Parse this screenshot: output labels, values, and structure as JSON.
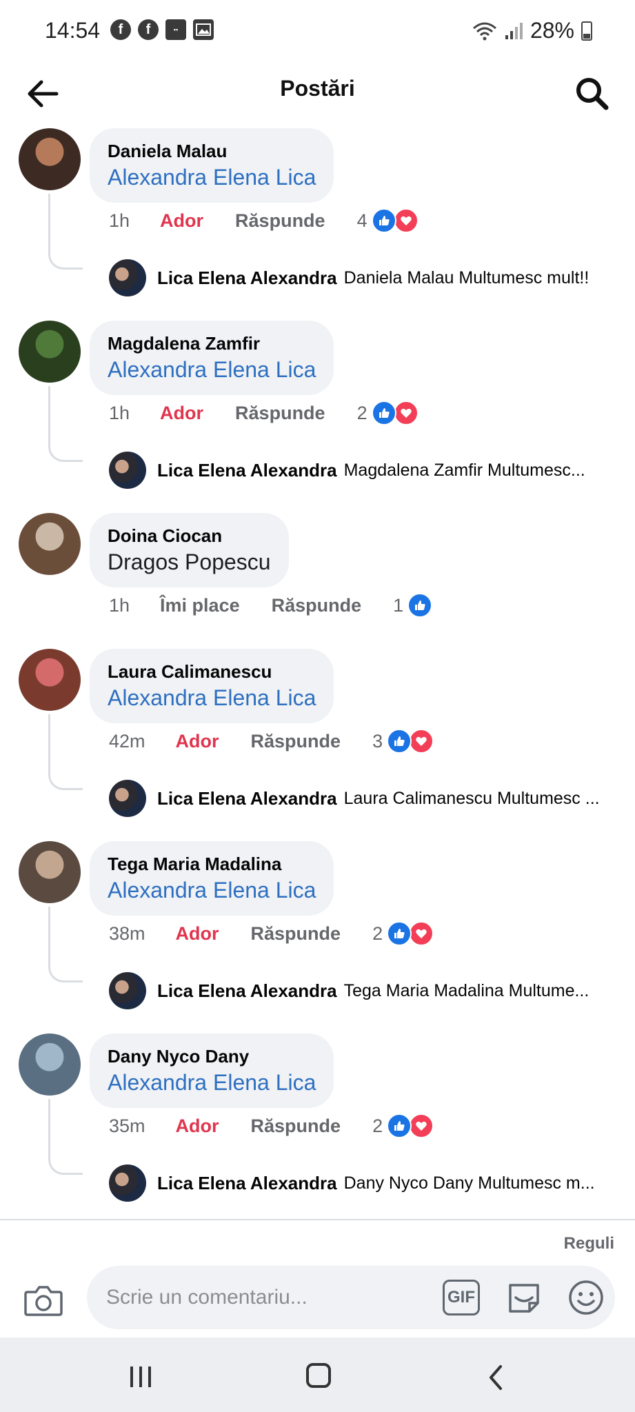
{
  "status_bar": {
    "time": "14:54",
    "battery": "28%",
    "left_icons": [
      "facebook-icon",
      "facebook-icon",
      "app-badge-icon",
      "gallery-icon"
    ]
  },
  "header": {
    "title": "Postări"
  },
  "colors": {
    "mention": "#2d6fc0",
    "love_reaction": "#e0354e",
    "like_blue": "#1b74e4",
    "bubble_bg": "#f0f2f5"
  },
  "comments": [
    {
      "author": "Daniela Malau",
      "text": "Alexandra Elena Lica",
      "is_mention": true,
      "time": "1h",
      "reaction_label": "Ador",
      "reply_label": "Răspunde",
      "reaction_count": "4",
      "reactions": [
        "like",
        "love"
      ],
      "reply": {
        "author": "Lica Elena Alexandra",
        "text": "Daniela Malau Multumesc mult!!"
      }
    },
    {
      "author": "Magdalena Zamfir",
      "text": "Alexandra Elena Lica",
      "is_mention": true,
      "time": "1h",
      "reaction_label": "Ador",
      "reply_label": "Răspunde",
      "reaction_count": "2",
      "reactions": [
        "like",
        "love"
      ],
      "reply": {
        "author": "Lica Elena Alexandra",
        "text": "Magdalena Zamfir Multumesc..."
      }
    },
    {
      "author": "Doina Ciocan",
      "text": "Dragos Popescu",
      "is_mention": false,
      "time": "1h",
      "reaction_label": "Îmi place",
      "reply_label": "Răspunde",
      "reaction_count": "1",
      "reactions": [
        "like"
      ]
    },
    {
      "author": "Laura Calimanescu",
      "text": "Alexandra Elena Lica",
      "is_mention": true,
      "time": "42m",
      "reaction_label": "Ador",
      "reply_label": "Răspunde",
      "reaction_count": "3",
      "reactions": [
        "like",
        "love"
      ],
      "reply": {
        "author": "Lica Elena Alexandra",
        "text": "Laura Calimanescu Multumesc ..."
      }
    },
    {
      "author": "Tega Maria Madalina",
      "text": "Alexandra Elena Lica",
      "is_mention": true,
      "time": "38m",
      "reaction_label": "Ador",
      "reply_label": "Răspunde",
      "reaction_count": "2",
      "reactions": [
        "like",
        "love"
      ],
      "reply": {
        "author": "Lica Elena Alexandra",
        "text": "Tega Maria Madalina Multume..."
      }
    },
    {
      "author": "Dany Nyco Dany",
      "text": "Alexandra Elena Lica",
      "is_mention": true,
      "time": "35m",
      "reaction_label": "Ador",
      "reply_label": "Răspunde",
      "reaction_count": "2",
      "reactions": [
        "like",
        "love"
      ],
      "reply": {
        "author": "Lica Elena Alexandra",
        "text": "Dany Nyco Dany Multumesc m..."
      }
    }
  ],
  "composer": {
    "rules_label": "Reguli",
    "placeholder": "Scrie un comentariu...",
    "gif_label": "GIF"
  }
}
